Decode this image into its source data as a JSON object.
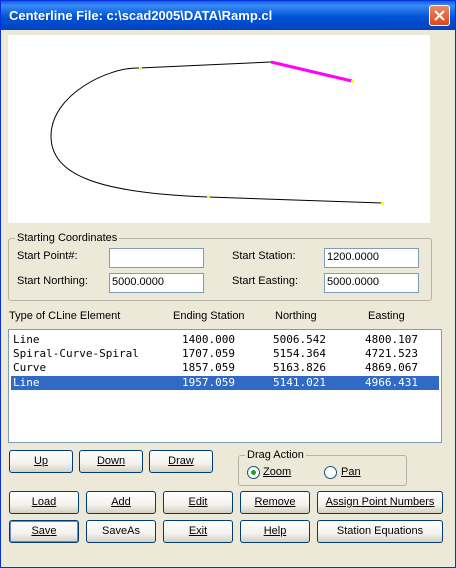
{
  "window": {
    "title": "Centerline File: c:\\scad2005\\DATA\\Ramp.cl"
  },
  "starting_coordinates": {
    "legend": "Starting Coordinates",
    "start_point_label": "Start Point#:",
    "start_point_value": "",
    "start_station_label": "Start Station:",
    "start_station_value": "1200.0000",
    "start_northing_label": "Start Northing:",
    "start_northing_value": "5000.0000",
    "start_easting_label": "Start Easting:",
    "start_easting_value": "5000.0000"
  },
  "table": {
    "headers": [
      "Type of CLine Element",
      "Ending Station",
      "Northing",
      "Easting"
    ],
    "rows": [
      {
        "type": "Line",
        "station": "1400.000",
        "northing": "5006.542",
        "easting": "4800.107",
        "selected": false
      },
      {
        "type": "Spiral-Curve-Spiral",
        "station": "1707.059",
        "northing": "5154.364",
        "easting": "4721.523",
        "selected": false
      },
      {
        "type": "Curve",
        "station": "1857.059",
        "northing": "5163.826",
        "easting": "4869.067",
        "selected": false
      },
      {
        "type": "Line",
        "station": "1957.059",
        "northing": "5141.021",
        "easting": "4966.431",
        "selected": true
      }
    ]
  },
  "buttons": {
    "up": "Up",
    "down": "Down",
    "draw": "Draw",
    "load": "Load",
    "add": "Add",
    "edit": "Edit",
    "remove": "Remove",
    "assign_point_numbers": "Assign Point Numbers",
    "save": "Save",
    "save_as": "SaveAs",
    "exit": "Exit",
    "help": "Help",
    "station_equations": "Station Equations"
  },
  "drag_action": {
    "legend": "Drag Action",
    "options": [
      "Zoom",
      "Pan"
    ],
    "selected": "Zoom"
  },
  "colors": {
    "selected_row": "#316ac5",
    "highlight_segment": "#ff00ff",
    "point_marker": "#ffff00"
  }
}
